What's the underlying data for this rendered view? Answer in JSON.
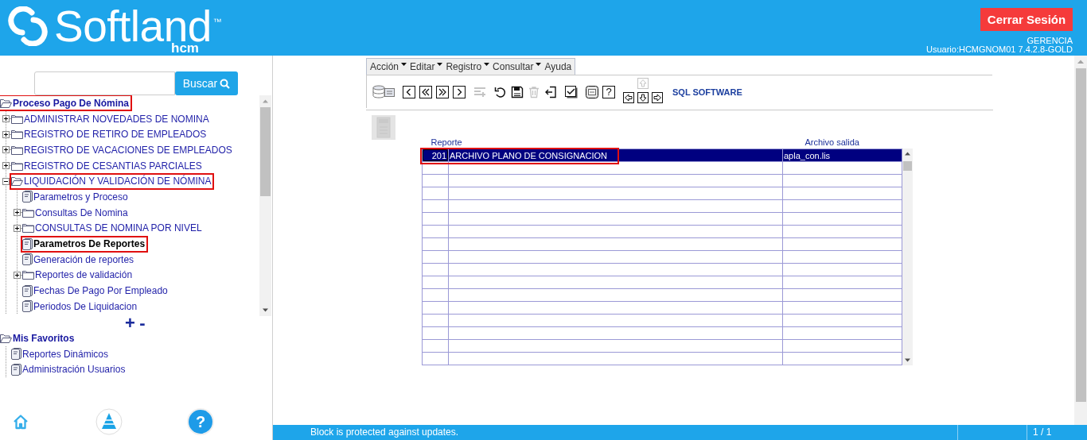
{
  "header": {
    "logo": "Softland$^{™}$",
    "product": "hcm",
    "logout_button": "Cerrar Sesión",
    "role": "GERENCIA",
    "user_info": "Usuario:HCMGNOM01 7.4.2.8-GOLD"
  },
  "sidebar": {
    "search": {
      "button": "Buscar"
    },
    "tree": [
      {
        "label": "Proceso Pago De Nómina",
        "kind": "folder",
        "expanded": true,
        "selected": false,
        "highlighted": true,
        "children": [
          {
            "label": "ADMINISTRAR NOVEDADES DE NOMINA",
            "kind": "folder",
            "expanded": false,
            "selected": false,
            "highlighted": false
          },
          {
            "label": "REGISTRO DE RETIRO DE EMPLEADOS",
            "kind": "folder",
            "expanded": false,
            "selected": false,
            "highlighted": false
          },
          {
            "label": "REGISTRO DE VACACIONES DE EMPLEADOS",
            "kind": "folder",
            "expanded": false,
            "selected": false,
            "highlighted": false
          },
          {
            "label": "REGISTRO DE CESANTIAS PARCIALES",
            "kind": "folder",
            "expanded": false,
            "selected": false,
            "highlighted": false
          },
          {
            "label": "LIQUIDACIÓN Y VALIDACIÓN DE NÓMINA",
            "kind": "folder",
            "expanded": true,
            "selected": false,
            "highlighted": true,
            "children": [
              {
                "label": "Parametros y Proceso",
                "kind": "document",
                "selected": false,
                "highlighted": false
              },
              {
                "label": "Consultas De Nomina",
                "kind": "folder",
                "expanded": false,
                "selected": false,
                "highlighted": false
              },
              {
                "label": "CONSULTAS DE NOMINA POR NIVEL",
                "kind": "folder",
                "expanded": false,
                "selected": false,
                "highlighted": false
              },
              {
                "label": "Parametros De Reportes",
                "kind": "document",
                "selected": true,
                "highlighted": true
              },
              {
                "label": "Generación de reportes",
                "kind": "document",
                "selected": false,
                "highlighted": false
              },
              {
                "label": "Reportes de validación",
                "kind": "folder",
                "expanded": false,
                "selected": false,
                "highlighted": false
              },
              {
                "label": "Fechas De Pago Por Empleado",
                "kind": "document",
                "selected": false,
                "highlighted": false
              },
              {
                "label": "Periodos De Liquidacion",
                "kind": "document",
                "selected": false,
                "highlighted": false
              }
            ]
          }
        ]
      }
    ],
    "zoom_controls": [
      "+",
      "-"
    ],
    "favorites": [
      {
        "label": "Mis Favoritos",
        "kind": "folder",
        "expanded": true,
        "selected": false,
        "highlighted": false,
        "children": [
          {
            "label": "Reportes Dinámicos",
            "kind": "document",
            "selected": false,
            "highlighted": false
          },
          {
            "label": "Administración Usuarios",
            "kind": "document",
            "selected": false,
            "highlighted": false
          }
        ]
      }
    ],
    "help_button": "?"
  },
  "form": {
    "menu": [
      {
        "label": "Acción",
        "dropdown": true
      },
      {
        "label": "Editar",
        "dropdown": true
      },
      {
        "label": "Registro",
        "dropdown": true
      },
      {
        "label": "Consultar",
        "dropdown": true
      },
      {
        "label": "Ayuda",
        "dropdown": false
      }
    ],
    "toolbar": [
      {
        "kind": "database",
        "disabled": false
      },
      {
        "kind": "previous",
        "disabled": false
      },
      {
        "kind": "first",
        "disabled": false
      },
      {
        "kind": "last",
        "disabled": false
      },
      {
        "kind": "next",
        "disabled": false
      },
      {
        "kind": "insert",
        "disabled": true
      },
      {
        "kind": "undo",
        "disabled": false
      },
      {
        "kind": "save",
        "disabled": false
      },
      {
        "kind": "delete",
        "disabled": true
      },
      {
        "kind": "exit",
        "disabled": false
      },
      {
        "kind": "commit",
        "disabled": false
      },
      {
        "kind": "escape",
        "disabled": false
      },
      {
        "kind": "help",
        "label": "?",
        "disabled": false
      }
    ],
    "arrow_pad": [
      {
        "kind": "up",
        "disabled": true
      },
      {
        "kind": "left",
        "disabled": false
      },
      {
        "kind": "down",
        "disabled": false
      },
      {
        "kind": "right",
        "disabled": false
      }
    ],
    "vendor": "SQL SOFTWARE",
    "pdf_button": {
      "disabled": true
    },
    "table": {
      "columns": [
        "Reporte",
        "",
        "Archivo salida"
      ],
      "rows": [
        {
          "cells": [
            "201",
            "ARCHIVO PLANO DE CONSIGNACION",
            "apla_con.lis"
          ],
          "selected": true,
          "highlighted": true
        }
      ]
    }
  },
  "status_bar": {
    "message": "Block is protected against updates.",
    "page": "1 / 1"
  }
}
